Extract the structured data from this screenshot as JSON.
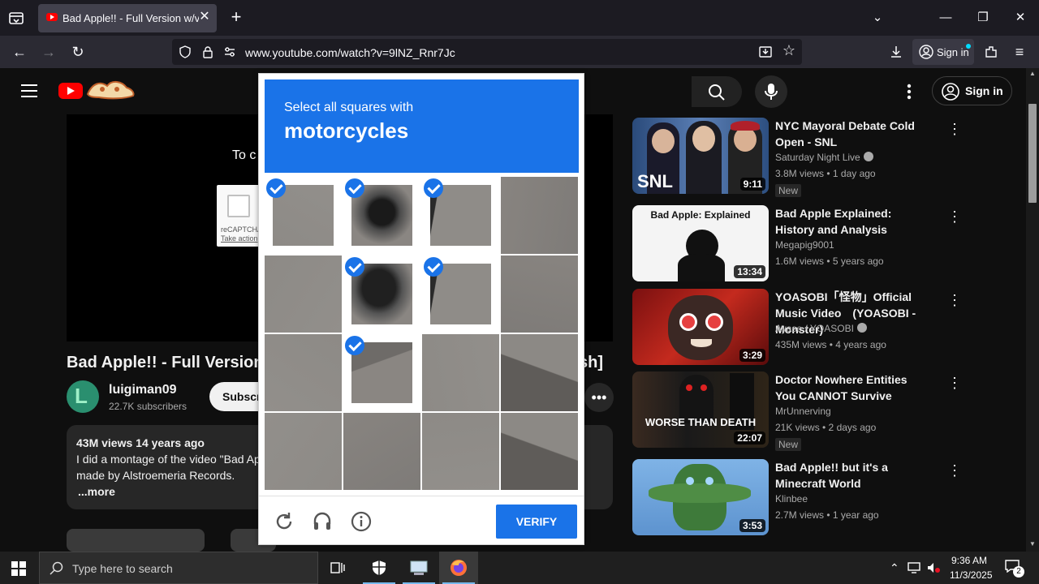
{
  "browser": {
    "tab_title": "Bad Apple!! - Full Version w/vid",
    "url": "www.youtube.com/watch?v=9lNZ_Rnr7Jc",
    "signin_label": "Sign in"
  },
  "youtube": {
    "signin_label": "Sign in",
    "player_message": "To c",
    "recaptcha_mini": {
      "label": "reCAPTCHA",
      "link": "Take action"
    },
    "video_title": "Bad Apple!! - Full Version w",
    "video_title_tail": "sh]",
    "channel": {
      "name": "luigiman09",
      "subscribers": "22.7K subscribers"
    },
    "subscribe_label": "Subscr",
    "description": {
      "meta": "43M views  14 years ago",
      "line1": "I did a montage of the video \"Bad Ap",
      "line2": "made by Alstroemeria Records.",
      "more": "...more"
    },
    "recommendations": [
      {
        "title": "NYC Mayoral Debate Cold Open - SNL",
        "channel": "Saturday Night Live",
        "meta": "3.8M views • 1 day ago",
        "badge": "New",
        "duration": "9:11",
        "thumb_text": "SNL"
      },
      {
        "title": "Bad Apple Explained: History and Analysis",
        "channel": "Megapig9001",
        "meta": "1.6M views • 5 years ago",
        "badge": "",
        "duration": "13:34",
        "thumb_text": "Bad Apple: Explained"
      },
      {
        "title": "YOASOBI「怪物」Official Music Video　(YOASOBI - Monster)",
        "channel": "Ayase / YOASOBI",
        "meta": "435M views • 4 years ago",
        "badge": "",
        "duration": "3:29",
        "thumb_text": ""
      },
      {
        "title": "Doctor Nowhere Entities You CANNOT Survive",
        "channel": "MrUnnerving",
        "meta": "21K views • 2 days ago",
        "badge": "New",
        "duration": "22:07",
        "thumb_text": "WORSE THAN DEATH"
      },
      {
        "title": "Bad Apple!! but it's a Minecraft World",
        "channel": "Klinbee",
        "meta": "2.7M views • 1 year ago",
        "badge": "",
        "duration": "3:53",
        "thumb_text": ""
      }
    ]
  },
  "captcha": {
    "instruction": "Select all squares with",
    "target": "motorcycles",
    "verify_label": "VERIFY",
    "selected_tiles": [
      0,
      1,
      2,
      5,
      6,
      9
    ],
    "header_color": "#1a73e8"
  },
  "taskbar": {
    "search_placeholder": "Type here to search",
    "time": "9:36 AM",
    "date": "11/3/2025",
    "notification_count": "2"
  }
}
